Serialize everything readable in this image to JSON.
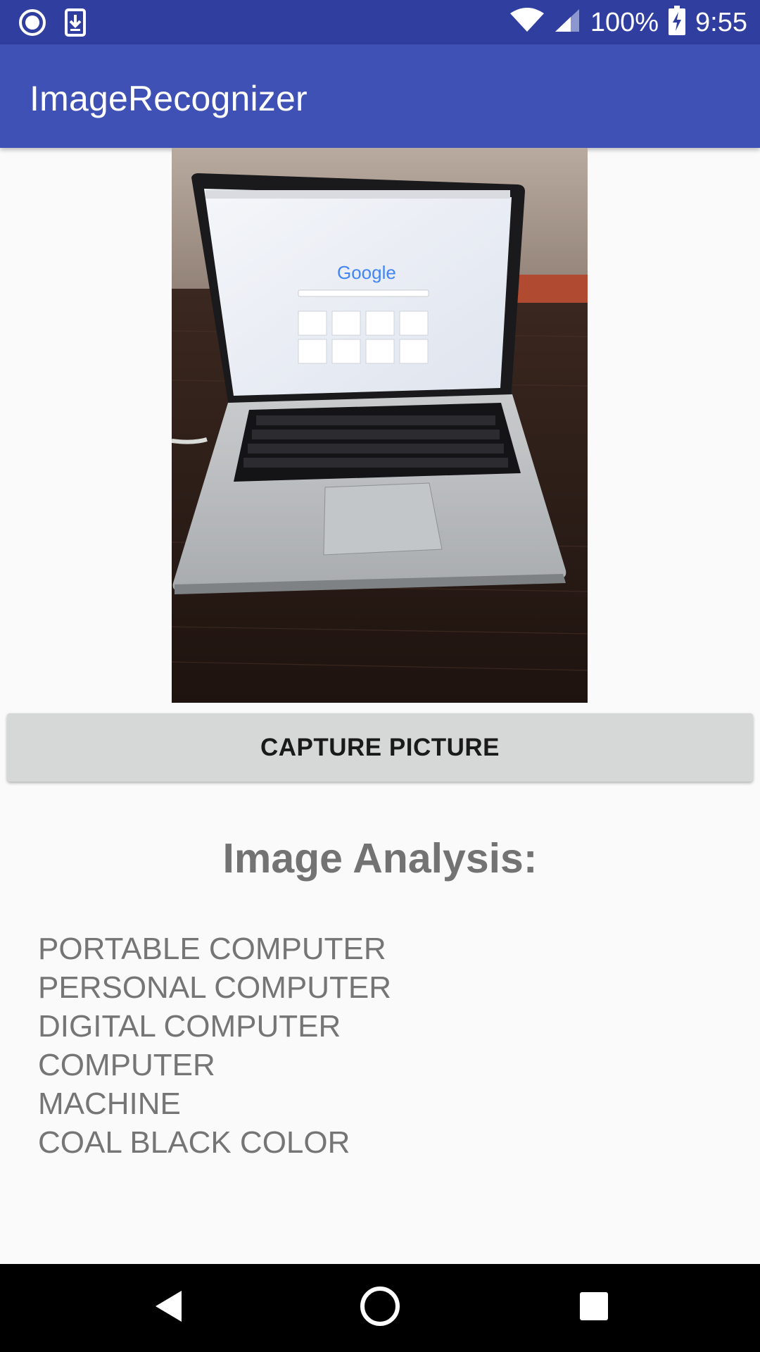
{
  "status_bar": {
    "battery_percent": "100%",
    "time": "9:55",
    "icons": [
      "record-icon",
      "download-icon",
      "wifi-icon",
      "signal-icon",
      "battery-charging-icon"
    ]
  },
  "app_bar": {
    "title": "ImageRecognizer"
  },
  "photo": {
    "description_icon": "captured-photo",
    "screen_logo_text": "Google"
  },
  "capture_button": {
    "label": "CAPTURE PICTURE"
  },
  "analysis": {
    "title": "Image Analysis:",
    "results": [
      "PORTABLE COMPUTER",
      "PERSONAL COMPUTER",
      "DIGITAL COMPUTER",
      "COMPUTER",
      "MACHINE",
      "COAL BLACK COLOR"
    ]
  },
  "nav_bar": {
    "icons": [
      "back-icon",
      "home-icon",
      "recents-icon"
    ]
  },
  "colors": {
    "status_bar": "#303f9f",
    "app_bar": "#3f51b5",
    "button": "#d6d7d7",
    "text_gray": "#757575"
  }
}
